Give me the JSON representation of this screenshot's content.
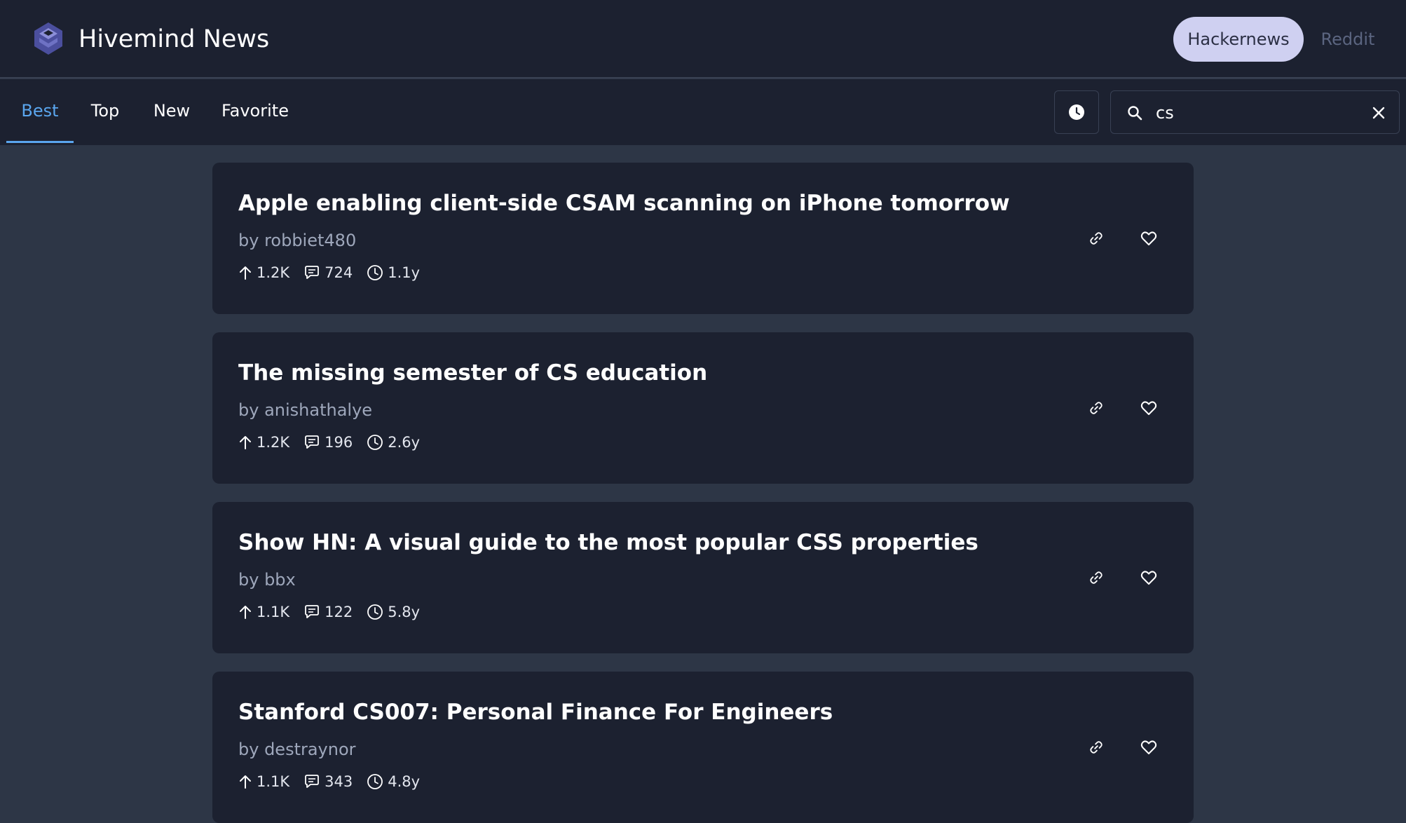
{
  "header": {
    "title": "Hivemind News",
    "logo_icon": "hivemind-logo",
    "sources": [
      {
        "label": "Hackernews",
        "active": true
      },
      {
        "label": "Reddit",
        "active": false
      }
    ]
  },
  "toolbar": {
    "tabs": [
      {
        "label": "Best",
        "active": true
      },
      {
        "label": "Top",
        "active": false
      },
      {
        "label": "New",
        "active": false
      },
      {
        "label": "Favorite",
        "active": false
      }
    ],
    "history_icon": "clock-icon",
    "search": {
      "value": "cs",
      "icon": "search-icon",
      "clear_icon": "close-icon"
    }
  },
  "stories": [
    {
      "title": "Apple enabling client-side CSAM scanning on iPhone tomorrow",
      "author": "by robbiet480",
      "points": "1.2K",
      "comments": "724",
      "age": "1.1y"
    },
    {
      "title": "The missing semester of CS education",
      "author": "by anishathalye",
      "points": "1.2K",
      "comments": "196",
      "age": "2.6y"
    },
    {
      "title": "Show HN: A visual guide to the most popular CSS properties",
      "author": "by bbx",
      "points": "1.1K",
      "comments": "122",
      "age": "5.8y"
    },
    {
      "title": "Stanford CS007: Personal Finance For Engineers",
      "author": "by destraynor",
      "points": "1.1K",
      "comments": "343",
      "age": "4.8y"
    }
  ],
  "colors": {
    "page_bg": "#2d3646",
    "panel_bg": "#1c2130",
    "accent": "#5aa6ee",
    "source_active_bg": "#cfd0f1",
    "muted_text": "#9ea7bb"
  }
}
